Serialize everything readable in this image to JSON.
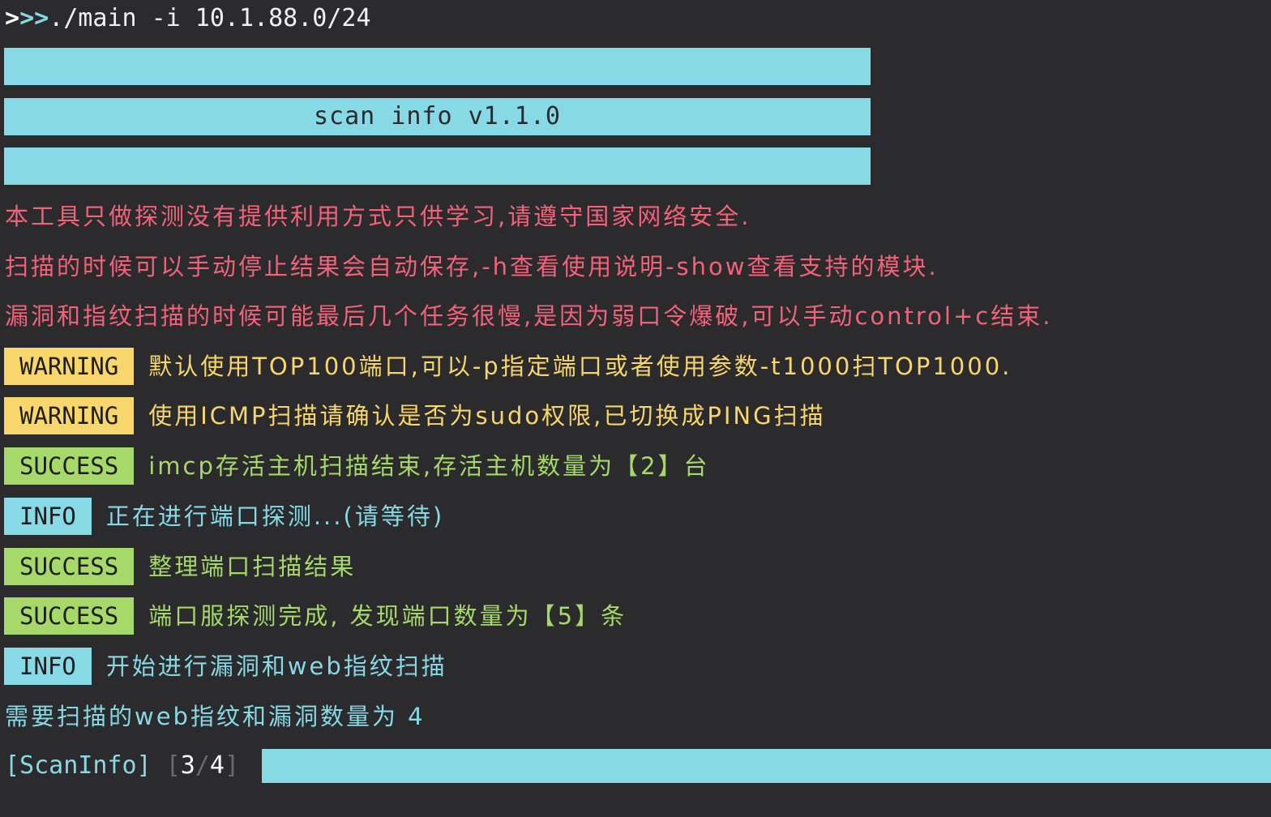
{
  "prompt": {
    "command": "./main  -i  10.1.88.0/24"
  },
  "banner": {
    "title": "scan info  v1.1.0"
  },
  "notices": [
    "本工具只做探测没有提供利用方式只供学习,请遵守国家网络安全.",
    "扫描的时候可以手动停止结果会自动保存,-h查看使用说明-show查看支持的模块.",
    "漏洞和指纹扫描的时候可能最后几个任务很慢,是因为弱口令爆破,可以手动control+c结束."
  ],
  "log": [
    {
      "level": "WARNING",
      "message": "默认使用TOP100端口,可以-p指定端口或者使用参数-t1000扫TOP1000."
    },
    {
      "level": "WARNING",
      "message": "使用ICMP扫描请确认是否为sudo权限,已切换成PING扫描"
    },
    {
      "level": "SUCCESS",
      "message": "imcp存活主机扫描结束,存活主机数量为【2】台"
    },
    {
      "level": "INFO",
      "message": "正在进行端口探测...(请等待)"
    },
    {
      "level": "SUCCESS",
      "message": "整理端口扫描结果"
    },
    {
      "level": "SUCCESS",
      "message": "端口服探测完成, 发现端口数量为【5】条"
    },
    {
      "level": "INFO",
      "message": "开始进行漏洞和web指纹扫描"
    }
  ],
  "summary": "需要扫描的web指纹和漏洞数量为  4",
  "progress": {
    "label": "[ScanInfo]",
    "current": "3",
    "separator": "/",
    "total": "4",
    "fraction": 0.75
  },
  "colors": {
    "background": "#2b2a2d",
    "cyan": "#87d9e6",
    "warning": "#f7d66b",
    "success": "#a6d96a",
    "error_pink": "#f2637a"
  }
}
